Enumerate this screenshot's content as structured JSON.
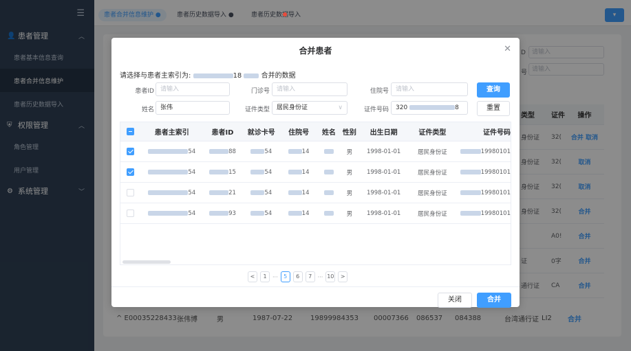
{
  "sidebar": {
    "toggle_icon": "menu-fold-icon",
    "groups": [
      {
        "label": "患者管理",
        "icon": "user-icon",
        "items": [
          "患者基本信息查询",
          "患者合并信息维护",
          "患者历史数据导入"
        ]
      },
      {
        "label": "权限管理",
        "icon": "shield-icon",
        "items": [
          "角色管理",
          "用户管理"
        ]
      },
      {
        "label": "系统管理",
        "icon": "gear-icon",
        "items": []
      }
    ]
  },
  "tabs": [
    "患者合并信息维护 ●",
    "患者历史数据导入 ●",
    "患者历史数据导入"
  ],
  "bg": {
    "search_placeholder": "请输入",
    "table_head": [
      "类型",
      "证件",
      "操作"
    ],
    "rows": [
      {
        "type": "身份证",
        "id": "32(",
        "op": "合并 取消"
      },
      {
        "type": "身份证",
        "id": "32(",
        "op": "取消"
      },
      {
        "type": "身份证",
        "id": "32(",
        "op": "取消"
      },
      {
        "type": "身份证",
        "id": "32(",
        "op": "合并"
      },
      {
        "type": "",
        "id": "A0!",
        "op": "合并"
      },
      {
        "type": "证",
        "id": "0字",
        "op": "合并"
      },
      {
        "type": "通行证",
        "id": "CA",
        "op": "合并"
      }
    ],
    "bottom_row": [
      "^ E00035228433",
      "张伟博",
      "男",
      "1987-07-22",
      "19899984353",
      "00007366",
      "086537",
      "084388",
      "台湾通行证",
      "LI2",
      "合并"
    ]
  },
  "dialog": {
    "title": "合并患者",
    "subtitle_prefix": "请选择与患者主索引为:",
    "subtitle_mid": "18",
    "subtitle_suffix": "合并的数据",
    "labels": {
      "patient_id": "患者ID",
      "clinic_no": "门诊号",
      "hosp_no": "住院号",
      "name": "姓名",
      "cert_type": "证件类型",
      "cert_no": "证件号码"
    },
    "placeholder": "请输入",
    "name_value": "张伟",
    "cert_type_value": "居民身份证",
    "cert_no_prefix": "320",
    "cert_no_suffix": "8",
    "query_label": "查询",
    "reset_label": "重置",
    "columns": [
      "患者主索引",
      "患者ID",
      "就诊卡号",
      "住院号",
      "姓名",
      "性别",
      "出生日期",
      "证件类型",
      "证件号码"
    ],
    "rows": [
      {
        "checked": true,
        "idx": "54",
        "pid": "88",
        "card": "54",
        "hosp": "14",
        "sex": "男",
        "birth": "1998-01-01",
        "ctype": "居民身份证",
        "cno": "19980101"
      },
      {
        "checked": true,
        "idx": "54",
        "pid": "15",
        "card": "54",
        "hosp": "14",
        "sex": "男",
        "birth": "1998-01-01",
        "ctype": "居民身份证",
        "cno": "19980101"
      },
      {
        "checked": false,
        "idx": "54",
        "pid": "21",
        "card": "54",
        "hosp": "14",
        "sex": "男",
        "birth": "1998-01-01",
        "ctype": "居民身份证",
        "cno": "19980101"
      },
      {
        "checked": false,
        "idx": "54",
        "pid": "93",
        "card": "54",
        "hosp": "14",
        "sex": "男",
        "birth": "1998-01-01",
        "ctype": "居民身份证",
        "cno": "19980101"
      }
    ],
    "pager": {
      "prev": "<",
      "pages": [
        "1",
        "5",
        "6",
        "7",
        "10"
      ],
      "active": "5",
      "next": ">",
      "dots": "···"
    },
    "close_label": "关闭",
    "merge_label": "合并"
  }
}
